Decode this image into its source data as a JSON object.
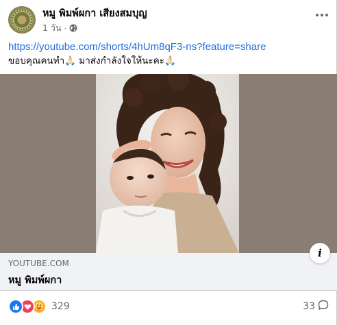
{
  "post": {
    "author": "หมู พิมพ์ผกา เสียงสมบุญ",
    "time": "1 วัน",
    "separator": "·",
    "link_text": "https://youtube.com/shorts/4hUm8qF3-ns?feature=share",
    "caption": "ขอบคุณคนทำ🙏🏻 มาส่งกำลังใจให้นะคะ🙏🏻"
  },
  "link_preview": {
    "domain": "YOUTUBE.COM",
    "title": "หมู พิมพ์ผกา"
  },
  "stats": {
    "reaction_count": "329",
    "comment_count": "33"
  },
  "icons": {
    "more": "more-horizontal-icon",
    "globe": "globe-icon",
    "info": "info-icon",
    "like": "like-reaction-icon",
    "love": "love-reaction-icon",
    "care": "care-reaction-icon",
    "comment": "comment-icon"
  },
  "colors": {
    "link": "#216fdb",
    "like": "#1877f2",
    "love": "#f33e58",
    "care": "#f7b125",
    "secondary_text": "#65676b"
  }
}
